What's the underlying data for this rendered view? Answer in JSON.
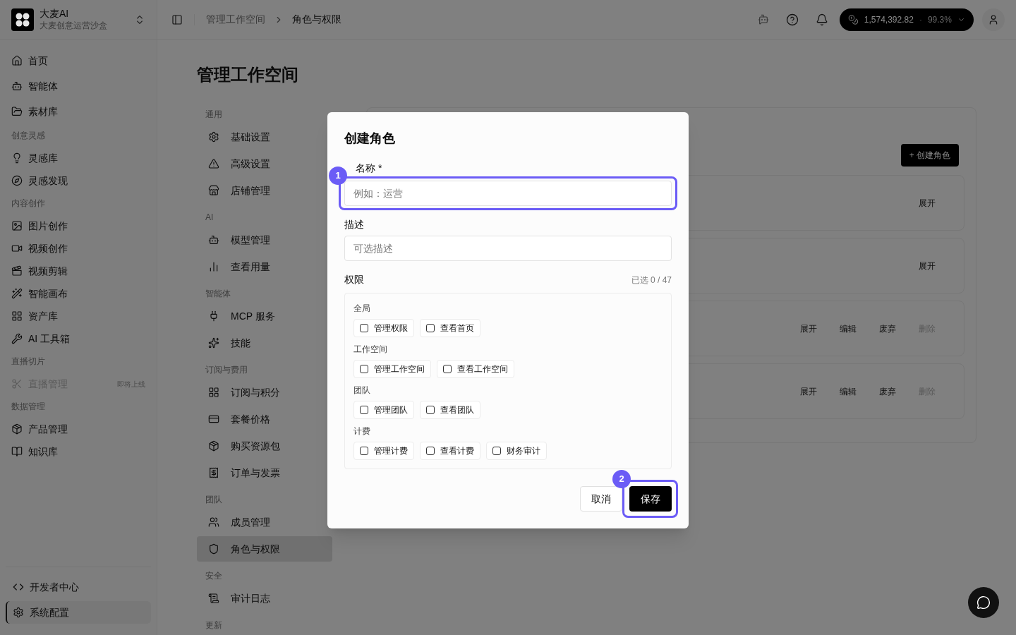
{
  "app": {
    "name": "大麦AI",
    "subtitle": "大麦创意运营沙盒"
  },
  "sidebar": {
    "sections": [
      {
        "items": [
          {
            "label": "首页",
            "disabled": false
          },
          {
            "label": "智能体",
            "disabled": false
          },
          {
            "label": "素材库",
            "disabled": false
          }
        ]
      },
      {
        "heading": "创意灵感",
        "items": [
          {
            "label": "灵感库",
            "disabled": false
          },
          {
            "label": "灵感发现",
            "disabled": false
          }
        ]
      },
      {
        "heading": "内容创作",
        "items": [
          {
            "label": "图片创作",
            "disabled": false
          },
          {
            "label": "视频创作",
            "disabled": false
          },
          {
            "label": "视频剪辑",
            "disabled": false
          },
          {
            "label": "智能画布",
            "disabled": false
          },
          {
            "label": "资产库",
            "disabled": false
          },
          {
            "label": "AI 工具箱",
            "disabled": false
          }
        ]
      },
      {
        "heading": "直播切片",
        "items": [
          {
            "label": "直播管理",
            "disabled": true,
            "badge": "即将上线"
          }
        ]
      },
      {
        "heading": "数据管理",
        "items": [
          {
            "label": "产品管理",
            "disabled": false
          },
          {
            "label": "知识库",
            "disabled": false
          }
        ]
      }
    ],
    "footer_items": [
      {
        "label": "开发者中心",
        "selected": false
      },
      {
        "label": "系统配置",
        "selected": true
      }
    ]
  },
  "header": {
    "breadcrumb": [
      "管理工作空间",
      "角色与权限"
    ],
    "balance": {
      "amount": "1,574,392.82",
      "separator": "·",
      "percent": "99.3%"
    }
  },
  "page": {
    "title": "管理工作空间",
    "settings_nav": [
      {
        "heading": "通用",
        "items": [
          {
            "label": "基础设置",
            "selected": false
          },
          {
            "label": "高级设置",
            "selected": false
          },
          {
            "label": "店铺管理",
            "selected": false
          }
        ]
      },
      {
        "heading": "AI",
        "items": [
          {
            "label": "模型管理",
            "selected": false
          },
          {
            "label": "查看用量",
            "selected": false
          }
        ]
      },
      {
        "heading": "智能体",
        "items": [
          {
            "label": "MCP 服务",
            "selected": false
          },
          {
            "label": "技能",
            "selected": false
          }
        ]
      },
      {
        "heading": "订阅与费用",
        "items": [
          {
            "label": "订阅与积分",
            "selected": false
          },
          {
            "label": "套餐价格",
            "selected": false
          },
          {
            "label": "购买资源包",
            "selected": false
          },
          {
            "label": "订单与发票",
            "selected": false
          }
        ]
      },
      {
        "heading": "团队",
        "items": [
          {
            "label": "成员管理",
            "selected": false
          },
          {
            "label": "角色与权限",
            "selected": true
          }
        ]
      },
      {
        "heading": "安全",
        "items": [
          {
            "label": "审计日志",
            "selected": false
          }
        ]
      },
      {
        "heading": "更新"
      }
    ],
    "create_button": "+ 创建角色",
    "roles": [
      {
        "actions": [
          {
            "label": "展开",
            "disabled": false
          }
        ]
      },
      {
        "actions": [
          {
            "label": "展开",
            "disabled": false
          }
        ]
      },
      {
        "actions": [
          {
            "label": "展开",
            "disabled": false
          },
          {
            "label": "编辑",
            "disabled": false
          },
          {
            "label": "废弃",
            "disabled": false
          },
          {
            "label": "删除",
            "disabled": true
          }
        ]
      },
      {
        "actions": [
          {
            "label": "展开",
            "disabled": false
          },
          {
            "label": "编辑",
            "disabled": false
          },
          {
            "label": "废弃",
            "disabled": false
          },
          {
            "label": "删除",
            "disabled": true
          }
        ]
      }
    ]
  },
  "dialog": {
    "title": "创建角色",
    "name_field": {
      "label": "名称 *",
      "placeholder": "例如：运营"
    },
    "description_field": {
      "label": "描述",
      "placeholder": "可选描述"
    },
    "permissions": {
      "label": "权限",
      "count": "已选 0 / 47",
      "groups": [
        {
          "label": "全局",
          "items": [
            {
              "label": "管理权限",
              "checked": false
            },
            {
              "label": "查看首页",
              "checked": false
            }
          ]
        },
        {
          "label": "工作空间",
          "items": [
            {
              "label": "管理工作空间",
              "checked": false
            },
            {
              "label": "查看工作空间",
              "checked": false
            }
          ]
        },
        {
          "label": "团队",
          "items": [
            {
              "label": "管理团队",
              "checked": false
            },
            {
              "label": "查看团队",
              "checked": false
            }
          ]
        },
        {
          "label": "计费",
          "items": [
            {
              "label": "管理计费",
              "checked": false
            },
            {
              "label": "查看计费",
              "checked": false
            },
            {
              "label": "财务审计",
              "checked": false
            }
          ]
        }
      ]
    },
    "cancel": "取消",
    "save": "保存",
    "annotations": [
      {
        "label": "1"
      },
      {
        "label": "2"
      }
    ]
  }
}
